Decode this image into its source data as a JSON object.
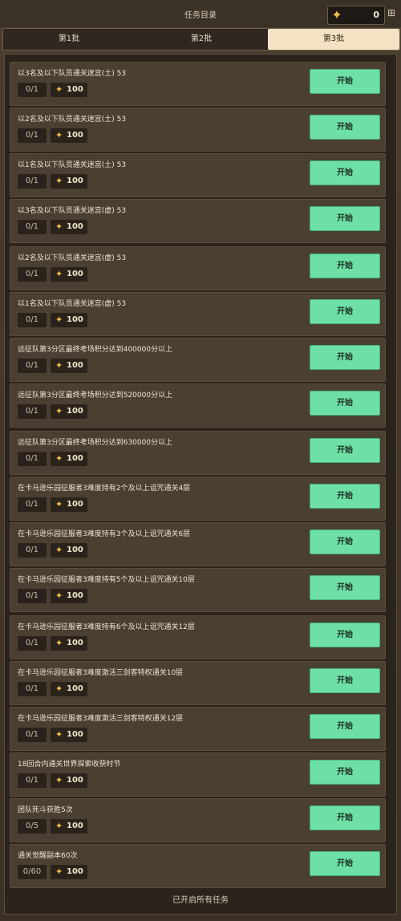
{
  "header": {
    "title": "任务目录",
    "currency_amount": "0"
  },
  "tabs": [
    {
      "label": "第1批",
      "active": false
    },
    {
      "label": "第2批",
      "active": false
    },
    {
      "label": "第3批",
      "active": true
    }
  ],
  "tasks": [
    {
      "name": "以3名及以下队员通关迷宫(土) 53",
      "progress": "0/1",
      "reward": "100",
      "button": "开始"
    },
    {
      "name": "以2名及以下队员通关迷宫(土) 53",
      "progress": "0/1",
      "reward": "100",
      "button": "开始"
    },
    {
      "name": "以1名及以下队员通关迷宫(土) 53",
      "progress": "0/1",
      "reward": "100",
      "button": "开始"
    },
    {
      "name": "以3名及以下队员通关迷宫(虚) 53",
      "progress": "0/1",
      "reward": "100",
      "button": "开始"
    },
    {
      "name": "以2名及以下队员通关迷宫(虚) 53",
      "progress": "0/1",
      "reward": "100",
      "button": "开始"
    },
    {
      "name": "以1名及以下队员通关迷宫(虚) 53",
      "progress": "0/1",
      "reward": "100",
      "button": "开始"
    },
    {
      "name": "远征队第3分区最终考场积分达到400000分以上",
      "progress": "0/1",
      "reward": "100",
      "button": "开始"
    },
    {
      "name": "远征队第3分区最终考场积分达到520000分以上",
      "progress": "0/1",
      "reward": "100",
      "button": "开始"
    },
    {
      "name": "远征队第3分区最终考场积分达到630000分以上",
      "progress": "0/1",
      "reward": "100",
      "button": "开始"
    },
    {
      "name": "在卡马逊乐园征服者3难度持有2个及以上诅咒通关4层",
      "progress": "0/1",
      "reward": "100",
      "button": "开始"
    },
    {
      "name": "在卡马逊乐园征服者3难度持有3个及以上诅咒通关6层",
      "progress": "0/1",
      "reward": "100",
      "button": "开始"
    },
    {
      "name": "在卡马逊乐园征服者3难度持有5个及以上诅咒通关10层",
      "progress": "0/1",
      "reward": "100",
      "button": "开始"
    },
    {
      "name": "在卡马逊乐园征服者3难度持有6个及以上诅咒通关12层",
      "progress": "0/1",
      "reward": "100",
      "button": "开始"
    },
    {
      "name": "在卡马逊乐园征服者3难度激活三剑客特权通关10层",
      "progress": "0/1",
      "reward": "100",
      "button": "开始"
    },
    {
      "name": "在卡马逊乐园征服者3难度激活三剑客特权通关12层",
      "progress": "0/1",
      "reward": "100",
      "button": "开始"
    },
    {
      "name": "18回合内通关世界探索收获时节",
      "progress": "0/1",
      "reward": "100",
      "button": "开始"
    },
    {
      "name": "团队死斗获胜5次",
      "progress": "0/5",
      "reward": "100",
      "button": "开始"
    },
    {
      "name": "通关觉醒副本60次",
      "progress": "0/60",
      "reward": "100",
      "button": "开始"
    }
  ],
  "footer": {
    "status": "已开启所有任务"
  },
  "icons": {
    "currency": "four-point-star-icon",
    "gift": "gift-icon"
  },
  "colors": {
    "start_button": "#6ee0a6",
    "active_tab": "#f3e2c4",
    "reward_star": "#f2c14a"
  }
}
